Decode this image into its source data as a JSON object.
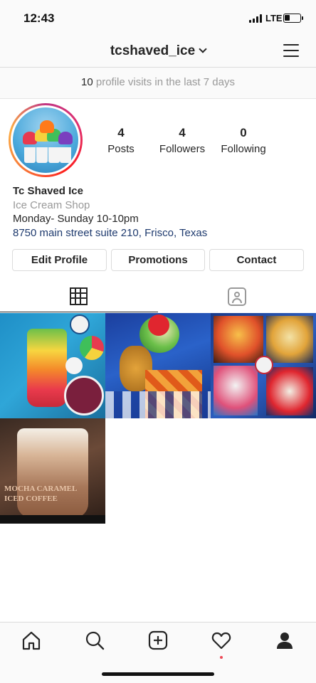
{
  "status_bar": {
    "time": "12:43",
    "network": "LTE",
    "icons": [
      "signal-icon",
      "battery-icon"
    ]
  },
  "header": {
    "username": "tcshaved_ice",
    "icons": [
      "chevron-down-icon",
      "menu-icon"
    ]
  },
  "insights": {
    "count": "10",
    "text": "profile visits in the last 7 days"
  },
  "profile": {
    "stats": {
      "posts_count": "4",
      "posts_label": "Posts",
      "followers_count": "4",
      "followers_label": "Followers",
      "following_count": "0",
      "following_label": "Following"
    },
    "name": "Tc Shaved Ice",
    "category": "Ice Cream Shop",
    "hours": "Monday- Sunday 10-10pm",
    "address": "8750 main street suite 210, Frisco, Texas"
  },
  "actions": {
    "edit_profile": "Edit Profile",
    "promotions": "Promotions",
    "contact": "Contact"
  },
  "tabs": [
    "grid-icon",
    "tagged-icon"
  ],
  "posts": [
    {
      "caption": ""
    },
    {
      "caption": ""
    },
    {
      "caption": ""
    },
    {
      "caption": "MOCHA CARAMEL\nICED COFFEE"
    }
  ],
  "bottom_nav": [
    "home-icon",
    "search-icon",
    "new-post-icon",
    "activity-icon",
    "profile-icon"
  ],
  "colors": {
    "link": "#1e3a6e",
    "muted": "#999999",
    "notification": "#ed4956",
    "text": "#262626"
  }
}
